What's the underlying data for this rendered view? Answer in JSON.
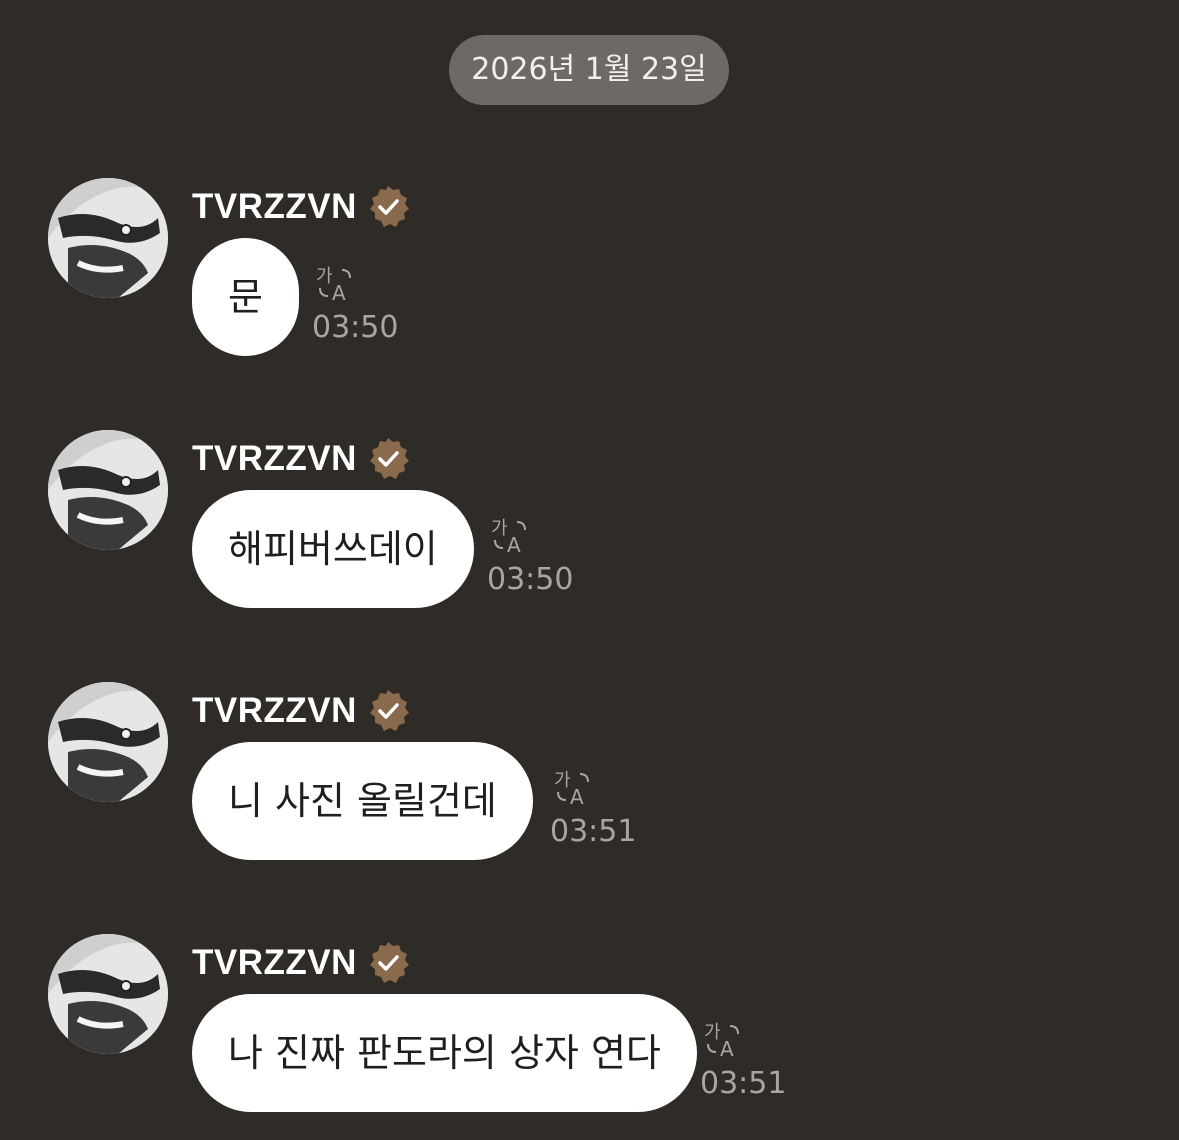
{
  "date_separator": "2026년 1월 23일",
  "colors": {
    "background": "#2f2b27",
    "date_pill": "#6d6a66",
    "bubble": "#ffffff",
    "verified_badge": "#8a6a4d",
    "time_text": "#a9a5a0"
  },
  "messages": [
    {
      "sender": "TVRZZVN",
      "verified": true,
      "text": "문",
      "time": "03:50",
      "translate_icon": "translate-icon"
    },
    {
      "sender": "TVRZZVN",
      "verified": true,
      "text": "해피버쓰데이",
      "time": "03:50",
      "translate_icon": "translate-icon"
    },
    {
      "sender": "TVRZZVN",
      "verified": true,
      "text": "니 사진 올릴건데",
      "time": "03:51",
      "translate_icon": "translate-icon"
    },
    {
      "sender": "TVRZZVN",
      "verified": true,
      "text": "나 진짜 판도라의 상자 연다",
      "time": "03:51",
      "translate_icon": "translate-icon"
    }
  ]
}
